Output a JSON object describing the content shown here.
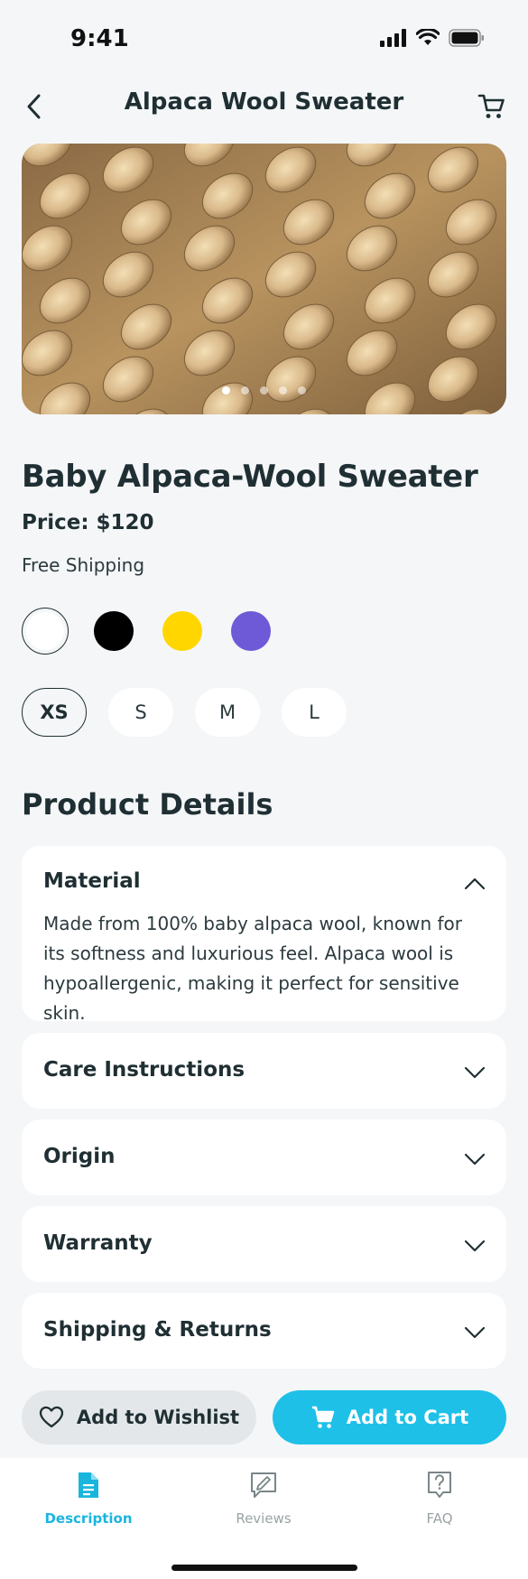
{
  "status_bar": {
    "time": "9:41"
  },
  "header": {
    "title": "Alpaca Wool Sweater",
    "back_icon": "chevron-left-icon",
    "cart_icon": "cart-icon"
  },
  "gallery": {
    "image": "cable-knit-wool-texture",
    "total_images": 5,
    "active_index": 0
  },
  "product": {
    "name": "Baby Alpaca-Wool Sweater",
    "price": "Price: $120",
    "shipping": "Free Shipping"
  },
  "colors": [
    {
      "name": "white",
      "hex": "#ffffff",
      "selected": true
    },
    {
      "name": "black",
      "hex": "#000000",
      "selected": false
    },
    {
      "name": "yellow",
      "hex": "#ffd600",
      "selected": false
    },
    {
      "name": "purple",
      "hex": "#6e5ad6",
      "selected": false
    }
  ],
  "sizes": [
    {
      "label": "XS",
      "selected": true
    },
    {
      "label": "S",
      "selected": false
    },
    {
      "label": "M",
      "selected": false
    },
    {
      "label": "L",
      "selected": false
    }
  ],
  "details": {
    "title": "Product Details",
    "sections": [
      {
        "title": "Material",
        "expanded": true,
        "body": "Made from 100% baby alpaca wool, known for its softness and luxurious feel. Alpaca wool is hypoallergenic, making it perfect for sensitive skin."
      },
      {
        "title": "Care Instructions",
        "expanded": false
      },
      {
        "title": "Origin",
        "expanded": false
      },
      {
        "title": "Warranty",
        "expanded": false
      },
      {
        "title": "Shipping & Returns",
        "expanded": false
      }
    ]
  },
  "actions": {
    "wishlist_label": "Add to Wishlist",
    "cart_label": "Add to Cart"
  },
  "tabs": [
    {
      "label": "Description",
      "icon": "document-icon",
      "active": true
    },
    {
      "label": "Reviews",
      "icon": "review-icon",
      "active": false
    },
    {
      "label": "FAQ",
      "icon": "faq-icon",
      "active": false
    }
  ],
  "colors_theme": {
    "accent": "#1ec0e8",
    "text": "#1f2f33",
    "background": "#f4f6f8"
  }
}
